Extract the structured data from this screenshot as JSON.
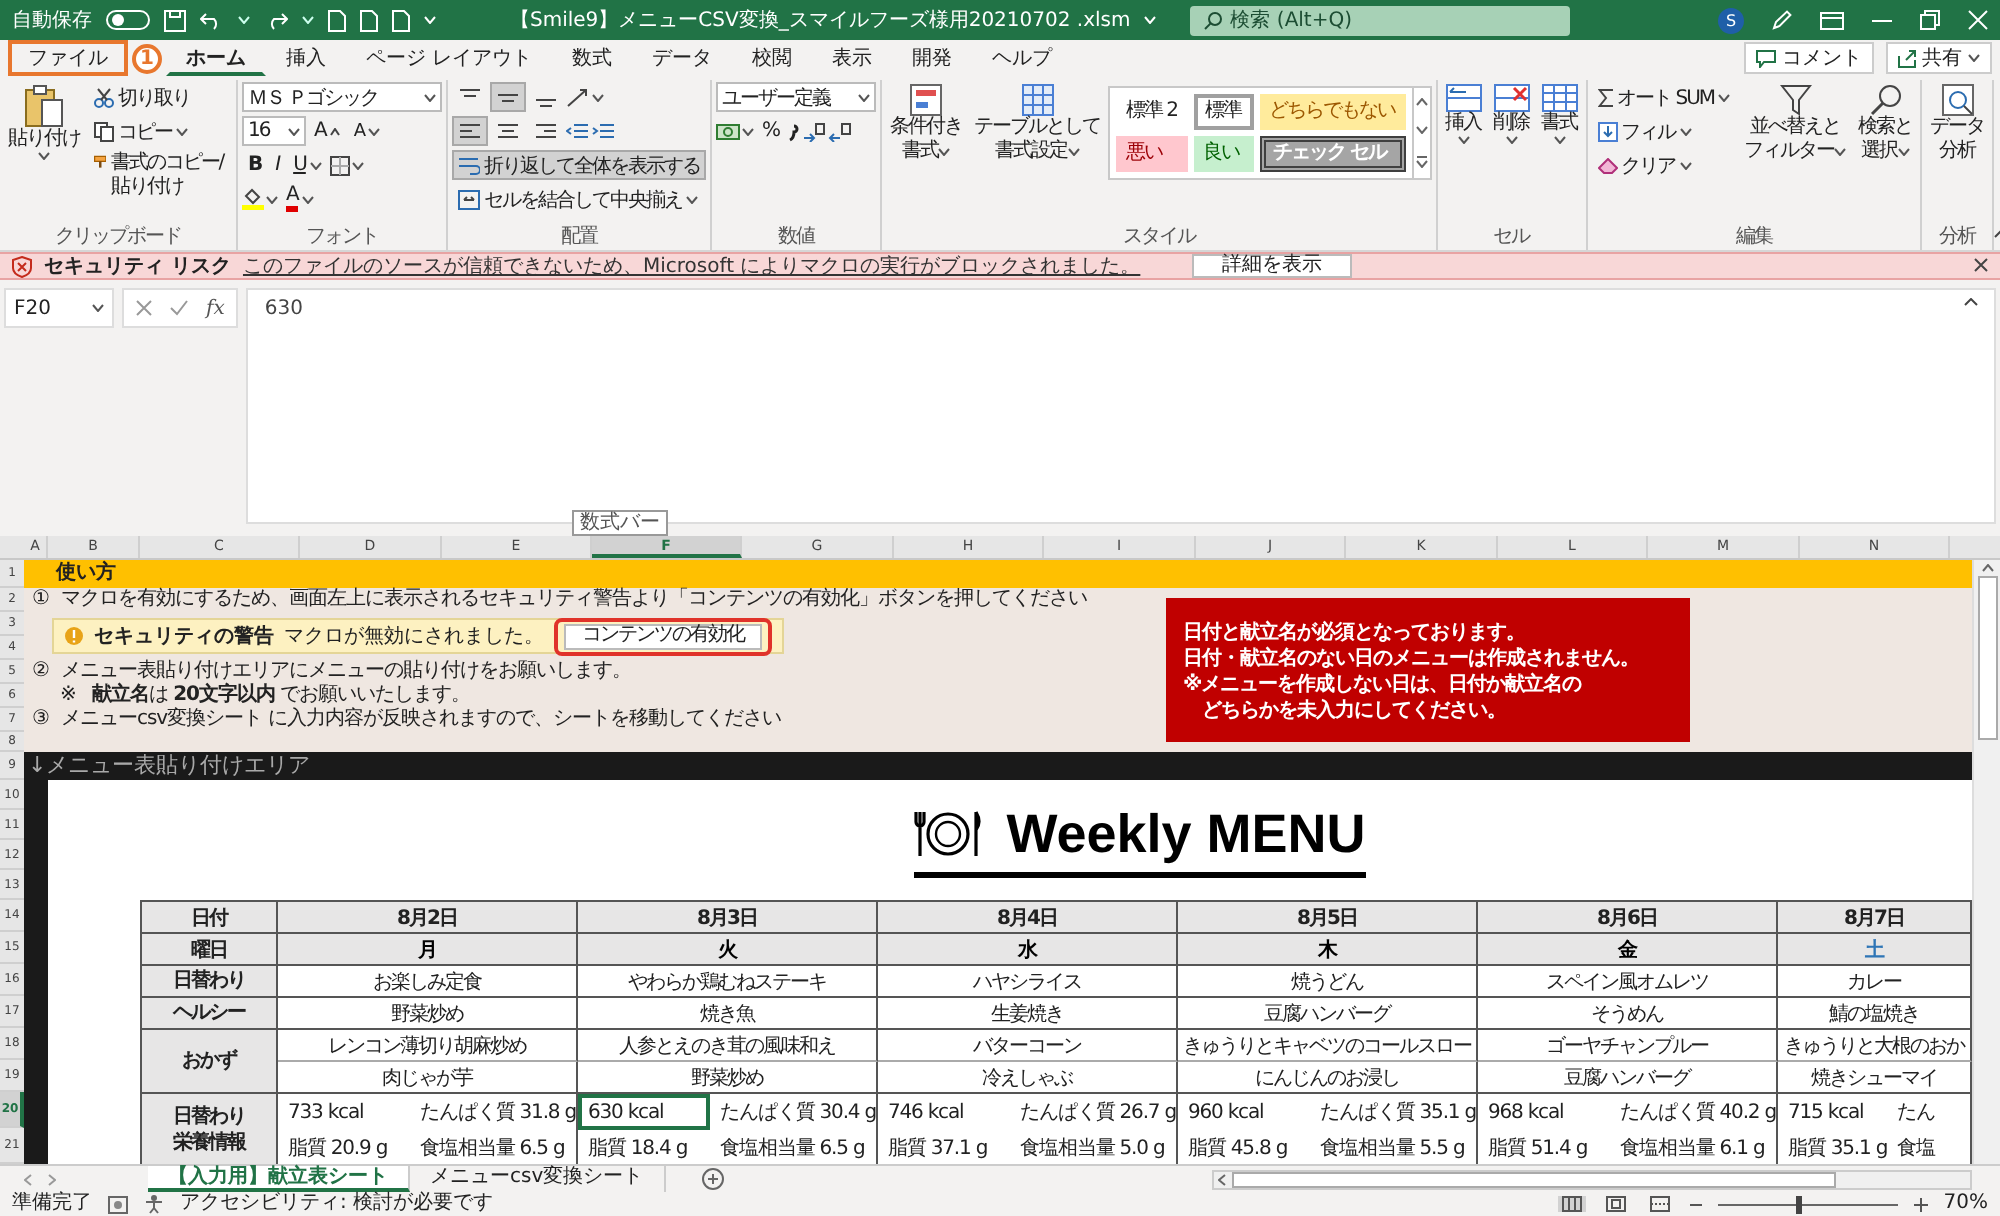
{
  "title_bar": {
    "autosave": {
      "label": "自動保存",
      "on": false
    },
    "title": "【Smile9】メニューCSV変換_スマイルフーズ様用20210702 .xlsm",
    "search": {
      "placeholder": "検索 (Alt+Q)"
    },
    "avatar": "S"
  },
  "menu_tabs": [
    {
      "label": "ファイル",
      "selected": false,
      "highlighted": true
    },
    {
      "label": "ホーム",
      "selected": true,
      "highlighted": false
    },
    {
      "label": "挿入",
      "selected": false,
      "highlighted": false
    },
    {
      "label": "ページ レイアウト",
      "selected": false,
      "highlighted": false
    },
    {
      "label": "数式",
      "selected": false,
      "highlighted": false
    },
    {
      "label": "データ",
      "selected": false,
      "highlighted": false
    },
    {
      "label": "校閲",
      "selected": false,
      "highlighted": false
    },
    {
      "label": "表示",
      "selected": false,
      "highlighted": false
    },
    {
      "label": "開発",
      "selected": false,
      "highlighted": false
    },
    {
      "label": "ヘルプ",
      "selected": false,
      "highlighted": false
    }
  ],
  "callout": {
    "number": "1"
  },
  "top_right_buttons": [
    {
      "label": "コメント",
      "kind": "comment"
    },
    {
      "label": "共有",
      "kind": "share"
    }
  ],
  "ribbon": {
    "clipboard": {
      "group": "クリップボード",
      "paste": "貼り付け",
      "cut": "切り取り",
      "copy": "コピー",
      "format_painter": "書式のコピー/貼り付け"
    },
    "font": {
      "group": "フォント",
      "font_name": "ＭＳ Ｐゴシック",
      "font_size": "16",
      "grow": "A",
      "shrink": "A",
      "font_styles": [
        "B",
        "I",
        "U"
      ],
      "font_color": "A"
    },
    "alignment": {
      "group": "配置",
      "vertical_align": [
        {
          "selected": false
        },
        {
          "selected": true
        },
        {
          "selected": false
        }
      ],
      "horizontal_align": [
        {
          "selected": true
        },
        {
          "selected": false
        },
        {
          "selected": false
        }
      ],
      "wrap_text": {
        "label": "折り返して全体を表示する",
        "on": true
      },
      "merge": "セルを結合して中央揃え"
    },
    "number": {
      "group": "数値",
      "format": "ユーザー定義",
      "percent": "%"
    },
    "styles": {
      "group": "スタイル",
      "conditional_format": [
        "条件付き",
        "書式"
      ],
      "format_as_table": [
        "テーブルとして",
        "書式設定"
      ],
      "cell_styles": [
        {
          "label": "標準 2",
          "kind": "normal2"
        },
        {
          "label": "標準",
          "kind": "normal"
        },
        {
          "label": "どちらでもない",
          "kind": "neutral"
        },
        {
          "label": "悪い",
          "kind": "bad"
        },
        {
          "label": "良い",
          "kind": "good"
        },
        {
          "label": "チェック セル",
          "kind": "check"
        }
      ]
    },
    "cells": {
      "group": "セル",
      "buttons": [
        {
          "label": "挿入",
          "kind": "insert"
        },
        {
          "label": "削除",
          "kind": "delete"
        },
        {
          "label": "書式",
          "kind": "format"
        }
      ]
    },
    "editing": {
      "group": "編集",
      "autosum": "オート SUM",
      "fill": "フィル",
      "clear": "クリア",
      "sort_filter": [
        "並べ替えと",
        "フィルター"
      ],
      "find_select": [
        "検索と",
        "選択"
      ]
    },
    "analysis": {
      "group": "分析",
      "analyze_data": [
        "データ",
        "分析"
      ]
    }
  },
  "security_bar": {
    "label": "セキュリティ リスク",
    "message": "このファイルのソースが信頼できないため、Microsoft によりマクロの実行がブロックされました。",
    "button": "詳細を表示"
  },
  "formula_bar": {
    "name_box": "F20",
    "function_button": "fx",
    "value": "630",
    "tooltip": "数式バー"
  },
  "columns": [
    {
      "label": "A",
      "selected": false
    },
    {
      "label": "B",
      "selected": false
    },
    {
      "label": "C",
      "selected": false
    },
    {
      "label": "D",
      "selected": false
    },
    {
      "label": "E",
      "selected": false
    },
    {
      "label": "F",
      "selected": true
    },
    {
      "label": "G",
      "selected": false
    },
    {
      "label": "H",
      "selected": false
    },
    {
      "label": "I",
      "selected": false
    },
    {
      "label": "J",
      "selected": false
    },
    {
      "label": "K",
      "selected": false
    },
    {
      "label": "L",
      "selected": false
    },
    {
      "label": "M",
      "selected": false
    },
    {
      "label": "N",
      "selected": false
    }
  ],
  "rows": [
    {
      "label": "1",
      "selected": false
    },
    {
      "label": "2",
      "selected": false
    },
    {
      "label": "3",
      "selected": false
    },
    {
      "label": "4",
      "selected": false
    },
    {
      "label": "5",
      "selected": false
    },
    {
      "label": "6",
      "selected": false
    },
    {
      "label": "7",
      "selected": false
    },
    {
      "label": "8",
      "selected": false
    },
    {
      "label": "9",
      "selected": false
    },
    {
      "label": "10",
      "selected": false
    },
    {
      "label": "11",
      "selected": false
    },
    {
      "label": "12",
      "selected": false
    },
    {
      "label": "13",
      "selected": false
    },
    {
      "label": "14",
      "selected": false
    },
    {
      "label": "15",
      "selected": false
    },
    {
      "label": "16",
      "selected": false
    },
    {
      "label": "17",
      "selected": false
    },
    {
      "label": "18",
      "selected": false
    },
    {
      "label": "19",
      "selected": false
    },
    {
      "label": "20",
      "selected": true
    },
    {
      "label": "21",
      "selected": false
    }
  ],
  "instructions": {
    "heading": "使い方",
    "items": [
      {
        "kind": "step",
        "number": "①",
        "text": "マクロを有効にするため、画面左上に表示されるセキュリティ警告より「コンテンツの有効化」ボタンを押してください"
      },
      {
        "kind": "warning_image",
        "title": "セキュリティの警告",
        "message": "マクロが無効にされました。",
        "button": "コンテンツの有効化"
      },
      {
        "kind": "step",
        "number": "②",
        "text": "メニュー表貼り付けエリアにメニューの貼り付けをお願いします。"
      },
      {
        "kind": "note",
        "mark": "※",
        "text": "**献立名**は  **20文字以内**  でお願いいたします。"
      },
      {
        "kind": "step",
        "number": "③",
        "text": "メニューcsv変換シート  に入力内容が反映されますので、シートを移動してください"
      }
    ],
    "notice": [
      "日付と献立名が必須となっております。",
      "日付・献立名のない日のメニューは作成されません。",
      "※メニューを作成しない日は、日付か献立名の",
      "　どちらかを未入力にしてください。"
    ]
  },
  "paste_area": {
    "label": "↓メニュー表貼り付けエリア"
  },
  "menu": {
    "title": "Weekly MENU",
    "row_headers": {
      "date": "日付",
      "weekday": "曜日",
      "daily": "日替わり",
      "healthy": "ヘルシー",
      "side": "おかず",
      "nutrition": [
        "日替わり",
        "栄養情報"
      ]
    },
    "days": [
      {
        "date": "8月2日",
        "weekday": "月",
        "color": "#000000",
        "daily": "お楽しみ定食",
        "healthy": "野菜炒め",
        "sides": [
          "レンコン薄切り胡麻炒め",
          "肉じゃが芋"
        ],
        "kcal": "733 kcal",
        "protein": "たんぱく質  31.8 g",
        "fat": "脂質  20.9 g",
        "salt": "食塩相当量  6.5 g",
        "selected": false
      },
      {
        "date": "8月3日",
        "weekday": "火",
        "color": "#000000",
        "daily": "やわらか鶏むねステーキ",
        "healthy": "焼き魚",
        "sides": [
          "人参とえのき茸の風味和え",
          "野菜炒め"
        ],
        "kcal": "630 kcal",
        "protein": "たんぱく質  30.4 g",
        "fat": "脂質  18.4 g",
        "salt": "食塩相当量  6.5 g",
        "selected": true
      },
      {
        "date": "8月4日",
        "weekday": "水",
        "color": "#000000",
        "daily": "ハヤシライス",
        "healthy": "生姜焼き",
        "sides": [
          "バターコーン",
          "冷えしゃぶ"
        ],
        "kcal": "746 kcal",
        "protein": "たんぱく質  26.7 g",
        "fat": "脂質  37.1 g",
        "salt": "食塩相当量  5.0 g",
        "selected": false
      },
      {
        "date": "8月5日",
        "weekday": "木",
        "color": "#000000",
        "daily": "焼うどん",
        "healthy": "豆腐ハンバーグ",
        "sides": [
          "きゅうりとキャベツのコールスロー",
          "にんじんのお浸し"
        ],
        "kcal": "960 kcal",
        "protein": "たんぱく質  35.1 g",
        "fat": "脂質  45.8 g",
        "salt": "食塩相当量  5.5 g",
        "selected": false
      },
      {
        "date": "8月6日",
        "weekday": "金",
        "color": "#000000",
        "daily": "スペイン風オムレツ",
        "healthy": "そうめん",
        "sides": [
          "ゴーヤチャンプルー",
          "豆腐ハンバーグ"
        ],
        "kcal": "968 kcal",
        "protein": "たんぱく質  40.2 g",
        "fat": "脂質  51.4 g",
        "salt": "食塩相当量  6.1 g",
        "selected": false
      },
      {
        "date": "8月7日",
        "weekday": "土",
        "color": "#2e75b6",
        "daily": "カレー",
        "healthy": "鯖の塩焼き",
        "sides": [
          "きゅうりと大根のおか",
          "焼きシューマイ"
        ],
        "kcal": "715 kcal",
        "protein": "たん",
        "fat": "脂質  35.1 g",
        "salt": "食塩",
        "selected": false
      }
    ]
  },
  "sheet_tabs": [
    {
      "label": "【入力用】献立表シート",
      "selected": true
    },
    {
      "label": "メニューcsv変換シート",
      "selected": false
    }
  ],
  "status_bar": {
    "ready": "準備完了",
    "accessibility": "アクセシビリティ: 検討が必要です",
    "views": [
      {
        "selected": true
      },
      {
        "selected": false
      },
      {
        "selected": false
      }
    ],
    "zoom_slider": {
      "level": 0.45
    },
    "zoom": "70%"
  }
}
